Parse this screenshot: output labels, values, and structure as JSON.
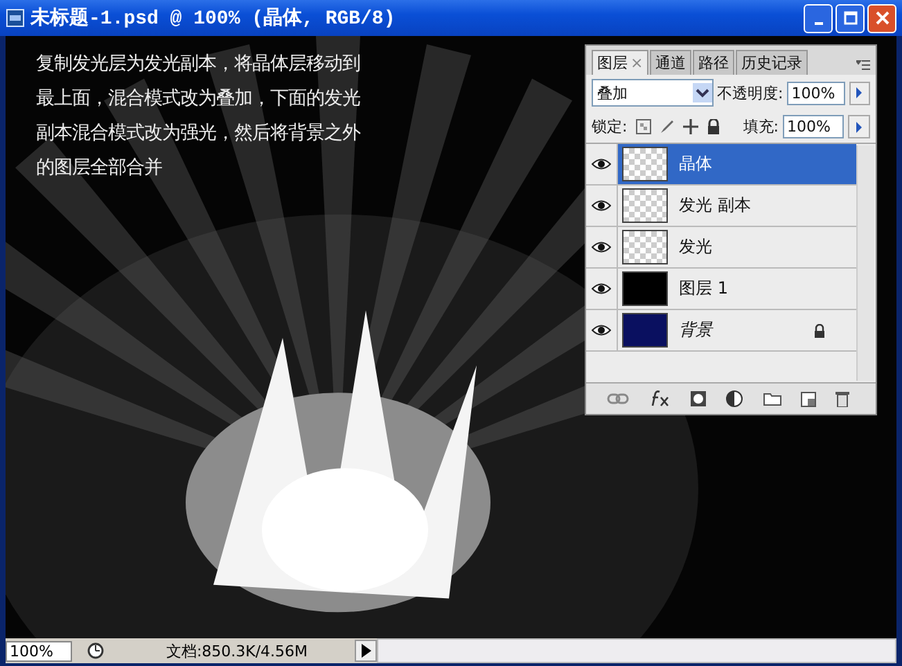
{
  "window": {
    "title": "未标题-1.psd @ 100% (晶体, RGB/8)"
  },
  "canvas": {
    "kind": "picture",
    "caption": "复制发光层为发光副本，将晶体层移动到最上面，混合模式改为叠加，下面的发光副本混合模式改为强光，然后将背景之外的图层全部合并"
  },
  "layers_panel": {
    "tabs": [
      {
        "label": "图层",
        "selected": true
      },
      {
        "label": "通道",
        "selected": false
      },
      {
        "label": "路径",
        "selected": false
      },
      {
        "label": "历史记录",
        "selected": false
      }
    ],
    "tab_close": "×",
    "blend_mode": "叠加",
    "opacity_label": "不透明度:",
    "opacity": "100%",
    "lock_label": "锁定:",
    "fill_label": "填充:",
    "fill": "100%",
    "layers": [
      {
        "name": "晶体",
        "thumbnail": {
          "kind": "transparent"
        },
        "visible": true,
        "selected": true,
        "locked": false,
        "kind": "layer"
      },
      {
        "name": "发光 副本",
        "thumbnail": {
          "kind": "transparent"
        },
        "visible": true,
        "selected": false,
        "locked": false,
        "kind": "layer"
      },
      {
        "name": "发光",
        "thumbnail": {
          "kind": "transparent"
        },
        "visible": true,
        "selected": false,
        "locked": false,
        "kind": "layer"
      },
      {
        "name": "图层 1",
        "thumbnail": {
          "kind": "black"
        },
        "visible": true,
        "selected": false,
        "locked": false,
        "kind": "layer"
      },
      {
        "name": "背景",
        "thumbnail": {
          "kind": "blue"
        },
        "visible": true,
        "selected": false,
        "locked": true,
        "kind": "background"
      }
    ]
  },
  "status_bar": {
    "zoom": "100%",
    "doc_info": "文档:850.3K/4.56M"
  }
}
